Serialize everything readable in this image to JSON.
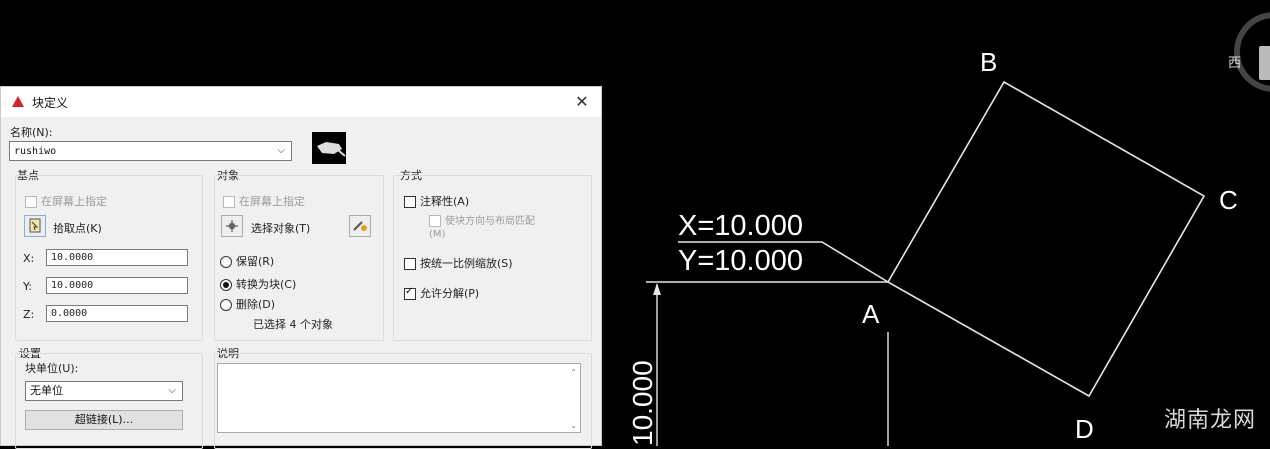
{
  "drawing": {
    "points": {
      "A": "A",
      "B": "B",
      "C": "C",
      "D": "D"
    },
    "tooltip_x": "X=10.000",
    "tooltip_y": "Y=10.000",
    "dimension": "10.000",
    "compass_label": "西"
  },
  "dialog": {
    "title": "块定义",
    "name_label": "名称(N):",
    "name_value": "rushiwo",
    "base_point": {
      "heading": "基点",
      "on_screen": "在屏幕上指定",
      "pick_point": "拾取点(K)",
      "x_label": "X:",
      "x_value": "10.0000",
      "y_label": "Y:",
      "y_value": "10.0000",
      "z_label": "Z:",
      "z_value": "0.0000"
    },
    "objects": {
      "heading": "对象",
      "on_screen": "在屏幕上指定",
      "select_objects": "选择对象(T)",
      "retain": "保留(R)",
      "convert": "转换为块(C)",
      "delete": "删除(D)",
      "selected_count": "已选择 4 个对象"
    },
    "behavior": {
      "heading": "方式",
      "annotative": "注释性(A)",
      "match_orientation": "使块方向与布局匹配(M)",
      "scale_uniformly": "按统一比例缩放(S)",
      "allow_explode": "允许分解(P)"
    },
    "settings": {
      "heading": "设置",
      "block_unit_label": "块单位(U):",
      "block_unit_value": "无单位",
      "hyperlink_button": "超链接(L)..."
    },
    "description": {
      "heading": "说明"
    },
    "close_symbol": "✕"
  },
  "watermark": "湖南龙网"
}
